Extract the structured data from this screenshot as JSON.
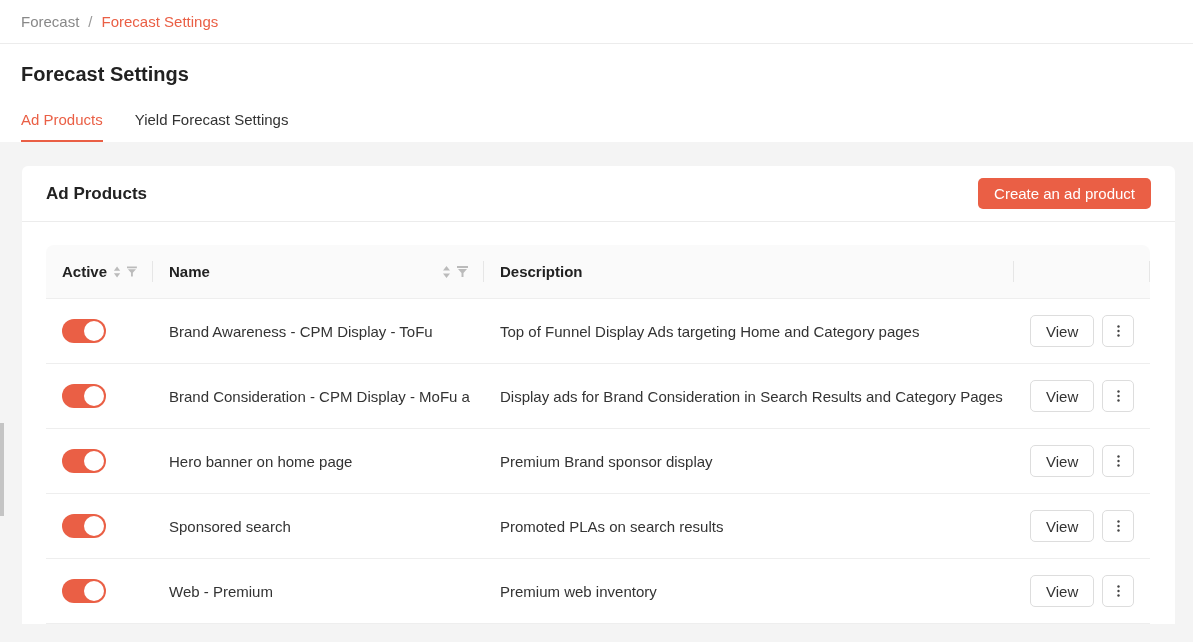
{
  "breadcrumb": {
    "separator": "/",
    "items": [
      {
        "label": "Forecast",
        "selected": false
      },
      {
        "label": "Forecast Settings",
        "selected": true
      }
    ]
  },
  "title": "Forecast Settings",
  "tabs": [
    {
      "label": "Ad Products",
      "selected": true
    },
    {
      "label": "Yield Forecast Settings",
      "selected": false
    }
  ],
  "card": {
    "title": "Ad Products",
    "create_button": "Create an ad product"
  },
  "table": {
    "columns": [
      {
        "label": "Active",
        "sortable": true,
        "filterable": true
      },
      {
        "label": "Name",
        "sortable": true,
        "filterable": true
      },
      {
        "label": "Description",
        "sortable": false,
        "filterable": false
      }
    ],
    "rows": [
      {
        "active": true,
        "name": "Brand Awareness - CPM Display - ToFu",
        "description": "Top of Funnel Display Ads targeting Home and Category pages",
        "view": "View"
      },
      {
        "active": true,
        "name": "Brand Consideration - CPM Display - MoFu a",
        "description": "Display ads for Brand Consideration in Search Results and Category Pages",
        "view": "View"
      },
      {
        "active": true,
        "name": "Hero banner on home page",
        "description": "Premium Brand sponsor display",
        "view": "View"
      },
      {
        "active": true,
        "name": "Sponsored search",
        "description": "Promoted PLAs on search results",
        "view": "View"
      },
      {
        "active": true,
        "name": "Web - Premium",
        "description": "Premium web inventory",
        "view": "View"
      }
    ]
  }
}
